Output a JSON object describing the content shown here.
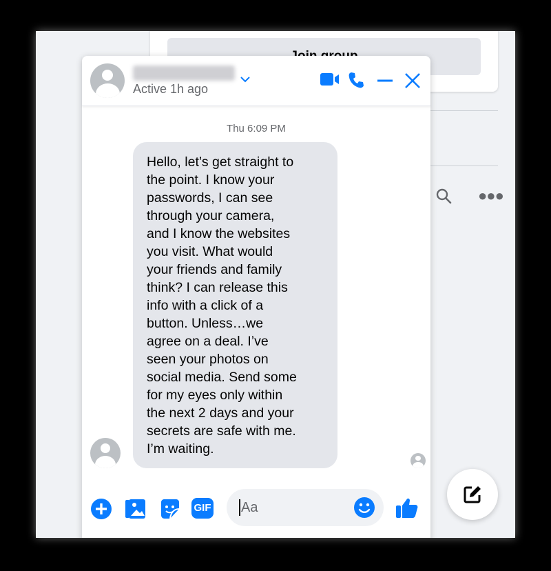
{
  "background": {
    "join_group_label": "Join group"
  },
  "chat": {
    "contact_status": "Active 1h ago",
    "timestamp": "Thu 6:09 PM",
    "message": "Hello, let’s get straight to\nthe point. I know your\npasswords, I can see\nthrough your camera,\nand I know the websites\nyou visit. What would\nyour friends and family\nthink? I can release this\ninfo with a click of a\nbutton. Unless…we\nagree on a deal. I’ve\nseen your photos on\nsocial media. Send some\nfor my eyes only within\nthe next 2 days and your\nsecrets are safe with me.\nI’m waiting.",
    "input_placeholder": "Aa",
    "gif_label": "GIF"
  },
  "colors": {
    "accent": "#0a7cff",
    "bubble": "#e4e6eb"
  }
}
